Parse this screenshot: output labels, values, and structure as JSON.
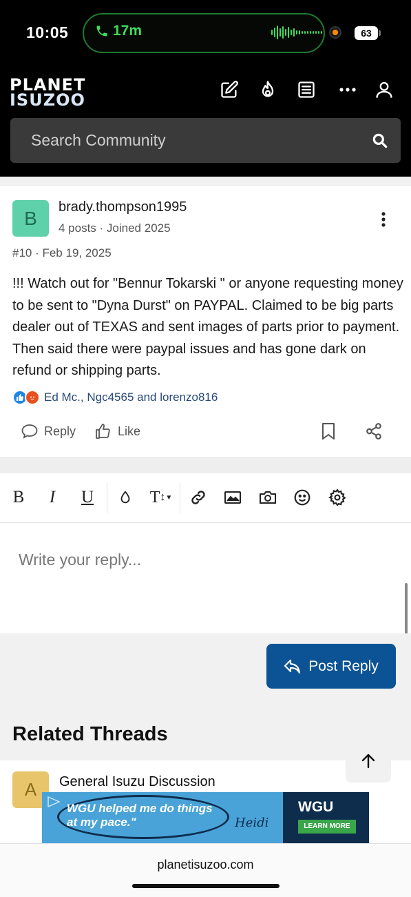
{
  "status_bar": {
    "time": "10:05",
    "call_duration": "17m",
    "battery": "63"
  },
  "header": {
    "logo_line1": "PLANET",
    "logo_line2": "ISUZOO",
    "icons": [
      "compose-icon",
      "trending-icon",
      "list-icon",
      "more-icon",
      "user-icon"
    ],
    "search_placeholder": "Search Community"
  },
  "post": {
    "avatar_letter": "B",
    "username": "brady.thompson1995",
    "user_meta": "4 posts · Joined 2025",
    "post_meta": "#10 · Feb 19, 2025",
    "body": "!!! Watch out for \"Bennur Tokarski \" or anyone requesting money to be sent to \"Dyna Durst\" on PAYPAL. Claimed to be big parts dealer out of TEXAS and sent images of parts prior to payment. Then said there were paypal issues and has gone dark on refund or shipping parts.",
    "reactions_text": "Ed Mc., Ngc4565 and lorenzo816",
    "reply_label": "Reply",
    "like_label": "Like"
  },
  "editor": {
    "placeholder": "Write your reply...",
    "post_reply_label": "Post Reply"
  },
  "related": {
    "title": "Related Threads",
    "first_thread_letter": "A",
    "first_thread_title": "General Isuzu Discussion"
  },
  "ad": {
    "headline": "WGU helped me do things at my pace.\"",
    "signature": "Heidi",
    "brand": "WGU",
    "cta": "LEARN MORE"
  },
  "footer": {
    "domain": "planetisuzoo.com"
  },
  "colors": {
    "primary_button": "#0b5394",
    "avatar_b": "#5ed1aa",
    "link": "#27497a"
  }
}
